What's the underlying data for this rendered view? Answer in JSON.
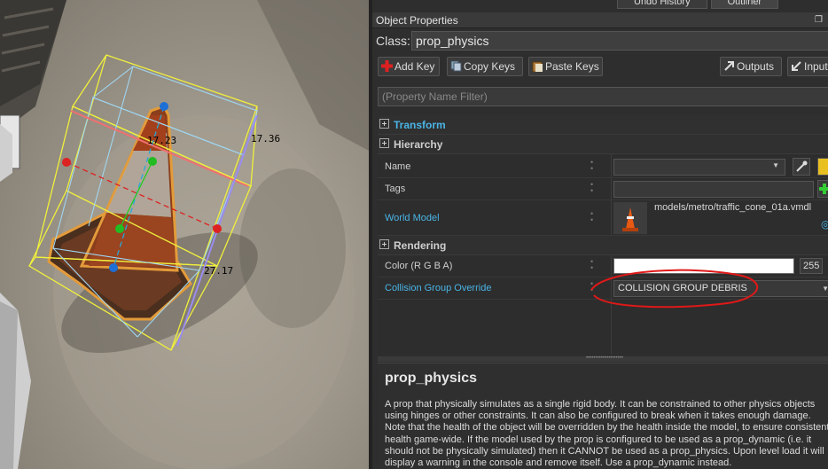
{
  "viewport": {
    "dims": [
      "17.23",
      "17.36",
      "27.17"
    ]
  },
  "panel": {
    "tabs": [
      "Undo History",
      "Outliner"
    ],
    "title": "Object Properties",
    "class_label": "Class:",
    "class_value": "prop_physics",
    "toolbar": {
      "add_keys": "Add Key",
      "copy_keys": "Copy Keys",
      "paste_keys": "Paste Keys",
      "outputs": "Outputs",
      "inputs": "Inputs"
    },
    "filter_placeholder": "(Property Name Filter)",
    "groups": {
      "transform": "Transform",
      "hierarchy": "Hierarchy",
      "rendering": "Rendering"
    },
    "properties": {
      "name": {
        "label": "Name",
        "value": ""
      },
      "tags": {
        "label": "Tags",
        "value": ""
      },
      "world_model": {
        "label": "World Model",
        "value": "models/metro/traffic_cone_01a.vmdl"
      },
      "color": {
        "label": "Color (R G B A)",
        "alpha": "255"
      },
      "collision": {
        "label": "Collision Group Override",
        "value": "COLLISION GROUP DEBRIS"
      }
    },
    "help": {
      "title": "prop_physics",
      "body": "A prop that physically simulates as a single rigid body. It can be constrained to other physics objects using hinges or other constraints. It can also be configured to break when it takes enough damage. Note that the health of the object will be overridden by the health inside the model, to ensure consistent health game-wide. If the model used by the prop is configured to be used as a prop_dynamic (i.e. it should not be physically simulated) then it CANNOT be used as a prop_physics. Upon level load it will display a warning in the console and remove itself. Use a prop_dynamic instead."
    }
  }
}
